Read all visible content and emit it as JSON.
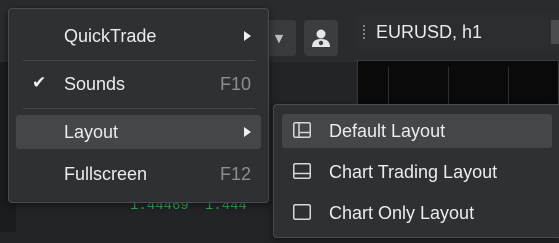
{
  "toolbar": {
    "symbol": "EURUSD, h1"
  },
  "prices": {
    "values": [
      "1.44469",
      "1.444"
    ]
  },
  "menu": {
    "items": [
      {
        "label": "QuickTrade",
        "has_submenu": true
      },
      {
        "label": "Sounds",
        "checked": true,
        "shortcut": "F10"
      },
      {
        "label": "Layout",
        "has_submenu": true
      },
      {
        "label": "Fullscreen",
        "shortcut": "F12"
      }
    ]
  },
  "submenu": {
    "items": [
      {
        "label": "Default Layout",
        "icon": "default-layout-icon"
      },
      {
        "label": "Chart Trading Layout",
        "icon": "chart-trading-layout-icon"
      },
      {
        "label": "Chart Only Layout",
        "icon": "chart-only-layout-icon"
      }
    ]
  },
  "colors": {
    "menu_bg": "#2f3033",
    "highlight": "#45464a",
    "text": "#ececec",
    "shortcut": "#8d8e91",
    "price_green": "#2fa84f"
  }
}
